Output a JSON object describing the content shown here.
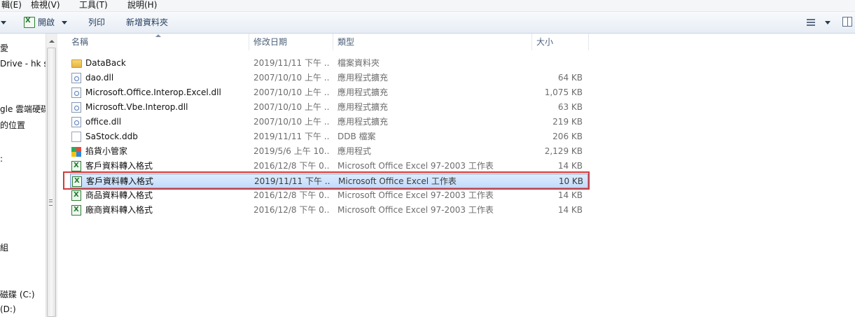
{
  "menu": [
    "輯(E)",
    "檢視(V)",
    "工具(T)",
    "說明(H)"
  ],
  "toolbar": {
    "open_label": "開啟",
    "print_label": "列印",
    "new_folder_label": "新增資料夾"
  },
  "nav": [
    "愛",
    "Drive - hk sa",
    "gle 雲端硬碟",
    "的位置",
    "組",
    "磁碟 (C:)",
    "(D:)"
  ],
  "columns": {
    "name": "名稱",
    "date": "修改日期",
    "type": "類型",
    "size": "大小"
  },
  "files": [
    {
      "name": "DataBack",
      "date": "2019/11/11 下午 ...",
      "type": "檔案資料夾",
      "size": "",
      "icon": "folder-icon"
    },
    {
      "name": "dao.dll",
      "date": "2007/10/10 上午 ...",
      "type": "應用程式擴充",
      "size": "64 KB",
      "icon": "dll-file-icon"
    },
    {
      "name": "Microsoft.Office.Interop.Excel.dll",
      "date": "2007/10/10 上午 ...",
      "type": "應用程式擴充",
      "size": "1,075 KB",
      "icon": "dll-file-icon"
    },
    {
      "name": "Microsoft.Vbe.Interop.dll",
      "date": "2007/10/10 上午 ...",
      "type": "應用程式擴充",
      "size": "63 KB",
      "icon": "dll-file-icon"
    },
    {
      "name": "office.dll",
      "date": "2007/10/10 上午 ...",
      "type": "應用程式擴充",
      "size": "219 KB",
      "icon": "dll-file-icon"
    },
    {
      "name": "SaStock.ddb",
      "date": "2019/11/11 下午 ...",
      "type": "DDB 檔案",
      "size": "206 KB",
      "icon": "blank-file-icon"
    },
    {
      "name": "掐貨小管家",
      "date": "2019/5/6 上午 10...",
      "type": "應用程式",
      "size": "2,129 KB",
      "icon": "app-icon"
    },
    {
      "name": "客戶資料轉入格式",
      "date": "2016/12/8 下午 0...",
      "type": "Microsoft Office Excel 97-2003 工作表",
      "size": "14 KB",
      "icon": "excel-file-icon"
    },
    {
      "name": "客戶資料轉入格式",
      "date": "2019/11/11 下午 ...",
      "type": "Microsoft Office Excel 工作表",
      "size": "10 KB",
      "icon": "excel-file-icon",
      "selected": true
    },
    {
      "name": "商品資料轉入格式",
      "date": "2016/12/8 下午 0...",
      "type": "Microsoft Office Excel 97-2003 工作表",
      "size": "14 KB",
      "icon": "excel-file-icon"
    },
    {
      "name": "廠商資料轉入格式",
      "date": "2016/12/8 下午 0...",
      "type": "Microsoft Office Excel 97-2003 工作表",
      "size": "14 KB",
      "icon": "excel-file-icon"
    }
  ],
  "colors": {
    "selection": "#c2dcfd",
    "highlight_border": "#d23a3a",
    "header_text": "#4c607a"
  }
}
